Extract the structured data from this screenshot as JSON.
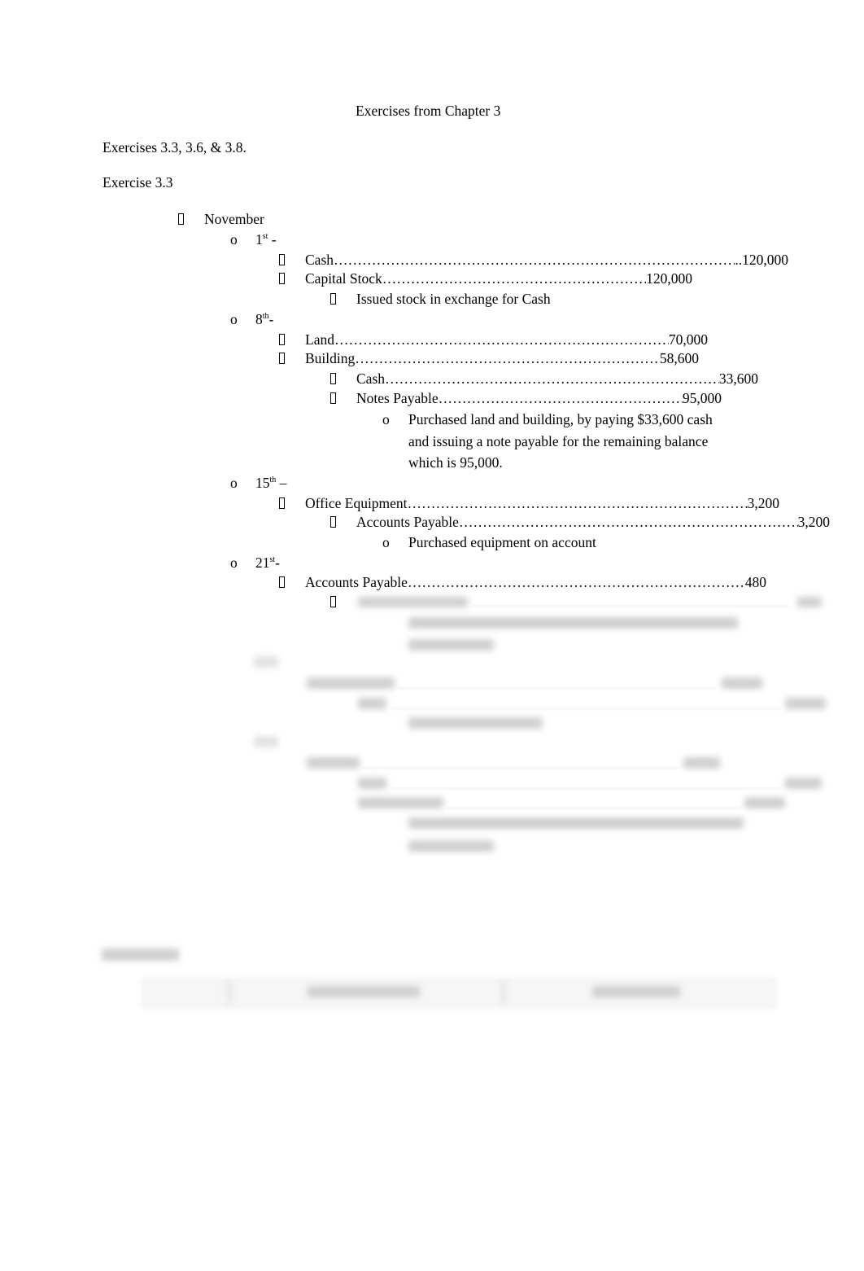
{
  "title": "Exercises from Chapter 3",
  "intro": "Exercises 3.3, 3.6, & 3.8.",
  "section": "Exercise 3.3",
  "month": "November",
  "leader": "……………………………………………………………………………………………………………………………………………………………",
  "entries": [
    {
      "day": "1",
      "suffix": "st",
      "tail": " -",
      "lines": [
        {
          "label": "Cash ",
          "amount": "..120,000"
        },
        {
          "label": "Capital Stock ",
          "amount": "120,000"
        }
      ],
      "credits": [],
      "memo": "Issued stock in exchange for Cash"
    },
    {
      "day": "8",
      "suffix": "th",
      "tail": "-",
      "lines": [
        {
          "label": "Land",
          "amount": "70,000"
        },
        {
          "label": "Building",
          "amount": "58,600"
        }
      ],
      "credits": [
        {
          "label": "Cash",
          "amount": "33,600"
        },
        {
          "label": "Notes Payable",
          "amount": "95,000"
        }
      ],
      "memo_lines": [
        "Purchased land and building, by paying $33,600 cash",
        "and issuing a note payable for the remaining balance",
        "which is 95,000."
      ]
    },
    {
      "day": "15",
      "suffix": "th",
      "tail": " –",
      "lines": [
        {
          "label": "Office Equipment",
          "amount": "3,200"
        }
      ],
      "credits": [
        {
          "label": "Accounts Payable",
          "amount": "3,200"
        }
      ],
      "memo": "Purchased equipment on account"
    },
    {
      "day": "21",
      "suffix": "st",
      "tail": "-",
      "lines": [
        {
          "label": "Accounts Payable",
          "amount": "480"
        }
      ]
    }
  ]
}
